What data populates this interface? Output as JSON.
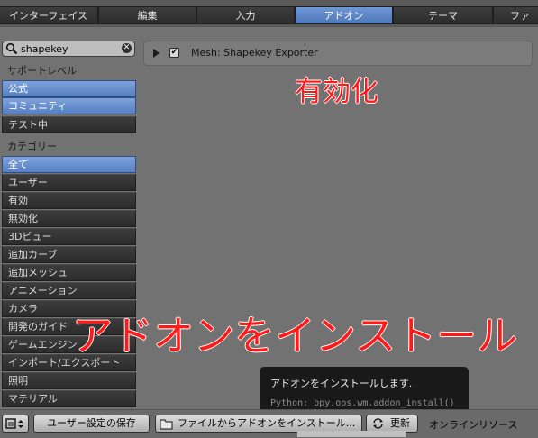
{
  "tabs": [
    "インターフェイス",
    "編集",
    "入力",
    "アドオン",
    "テーマ",
    "ファ"
  ],
  "active_tab": "アドオン",
  "search": {
    "value": "shapekey"
  },
  "support_level": {
    "label": "サポートレベル",
    "items": [
      "公式",
      "コミュニティ",
      "テスト中"
    ]
  },
  "category": {
    "label": "カテゴリー",
    "items": [
      "全て",
      "ユーザー",
      "有効",
      "無効化",
      "3Dビュー",
      "追加カーブ",
      "追加メッシュ",
      "アニメーション",
      "カメラ",
      "開発のガイド",
      "ゲームエンジン",
      "インポート/エクスポート",
      "照明",
      "マテリアル"
    ]
  },
  "addon": {
    "name": "Mesh: Shapekey Exporter",
    "enabled": true
  },
  "annotations": {
    "enable": "有効化",
    "install": "アドオンをインストール"
  },
  "tooltip": {
    "title": "アドオンをインストールします.",
    "python": "Python: bpy.ops.wm.addon_install()"
  },
  "bottom": {
    "save": "ユーザー設定の保存",
    "install": "ファイルからアドオンをインストール...",
    "refresh": "更新",
    "online": "オンラインリソース"
  },
  "colors": {
    "accent": "#5a83c6",
    "annotation": "#ff1a1a"
  }
}
